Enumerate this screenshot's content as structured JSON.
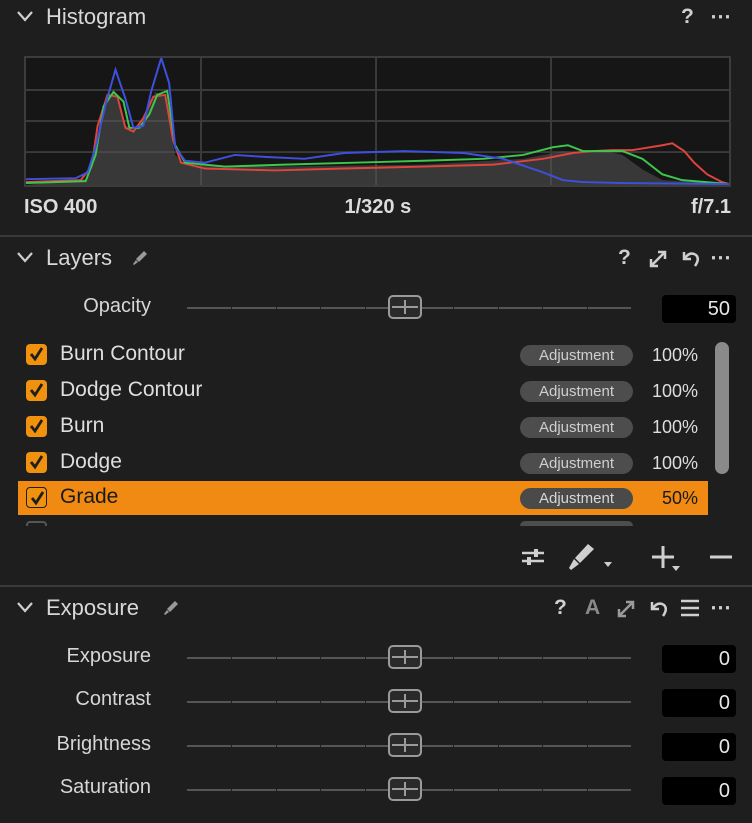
{
  "histogram": {
    "title": "Histogram",
    "iso": "ISO 400",
    "shutter": "1/320 s",
    "aperture": "f/7.1",
    "help": "?",
    "more": "⋯"
  },
  "layers": {
    "title": "Layers",
    "help": "?",
    "more": "⋯",
    "opacity_label": "Opacity",
    "opacity_value": "50",
    "opacity_level": 0.5,
    "items": [
      {
        "name": "Burn Contour",
        "badge": "Adjustment",
        "pct": "100%",
        "checked": true
      },
      {
        "name": "Dodge Contour",
        "badge": "Adjustment",
        "pct": "100%",
        "checked": true
      },
      {
        "name": "Burn",
        "badge": "Adjustment",
        "pct": "100%",
        "checked": true
      },
      {
        "name": "Dodge",
        "badge": "Adjustment",
        "pct": "100%",
        "checked": true
      },
      {
        "name": "Grade",
        "badge": "Adjustment",
        "pct": "50%",
        "checked": true,
        "selected": true
      }
    ]
  },
  "exposure": {
    "title": "Exposure",
    "help": "?",
    "auto": "A",
    "more": "⋯",
    "sliders": [
      {
        "label": "Exposure",
        "value": "0",
        "level": 0.5
      },
      {
        "label": "Contrast",
        "value": "0",
        "level": 0.5
      },
      {
        "label": "Brightness",
        "value": "0",
        "level": 0.5
      },
      {
        "label": "Saturation",
        "value": "0",
        "level": 0.5
      }
    ]
  },
  "colors": {
    "accent": "#f08a12",
    "histo_red": "#e0443c",
    "histo_green": "#3cc84a",
    "histo_blue": "#3e50e0"
  }
}
